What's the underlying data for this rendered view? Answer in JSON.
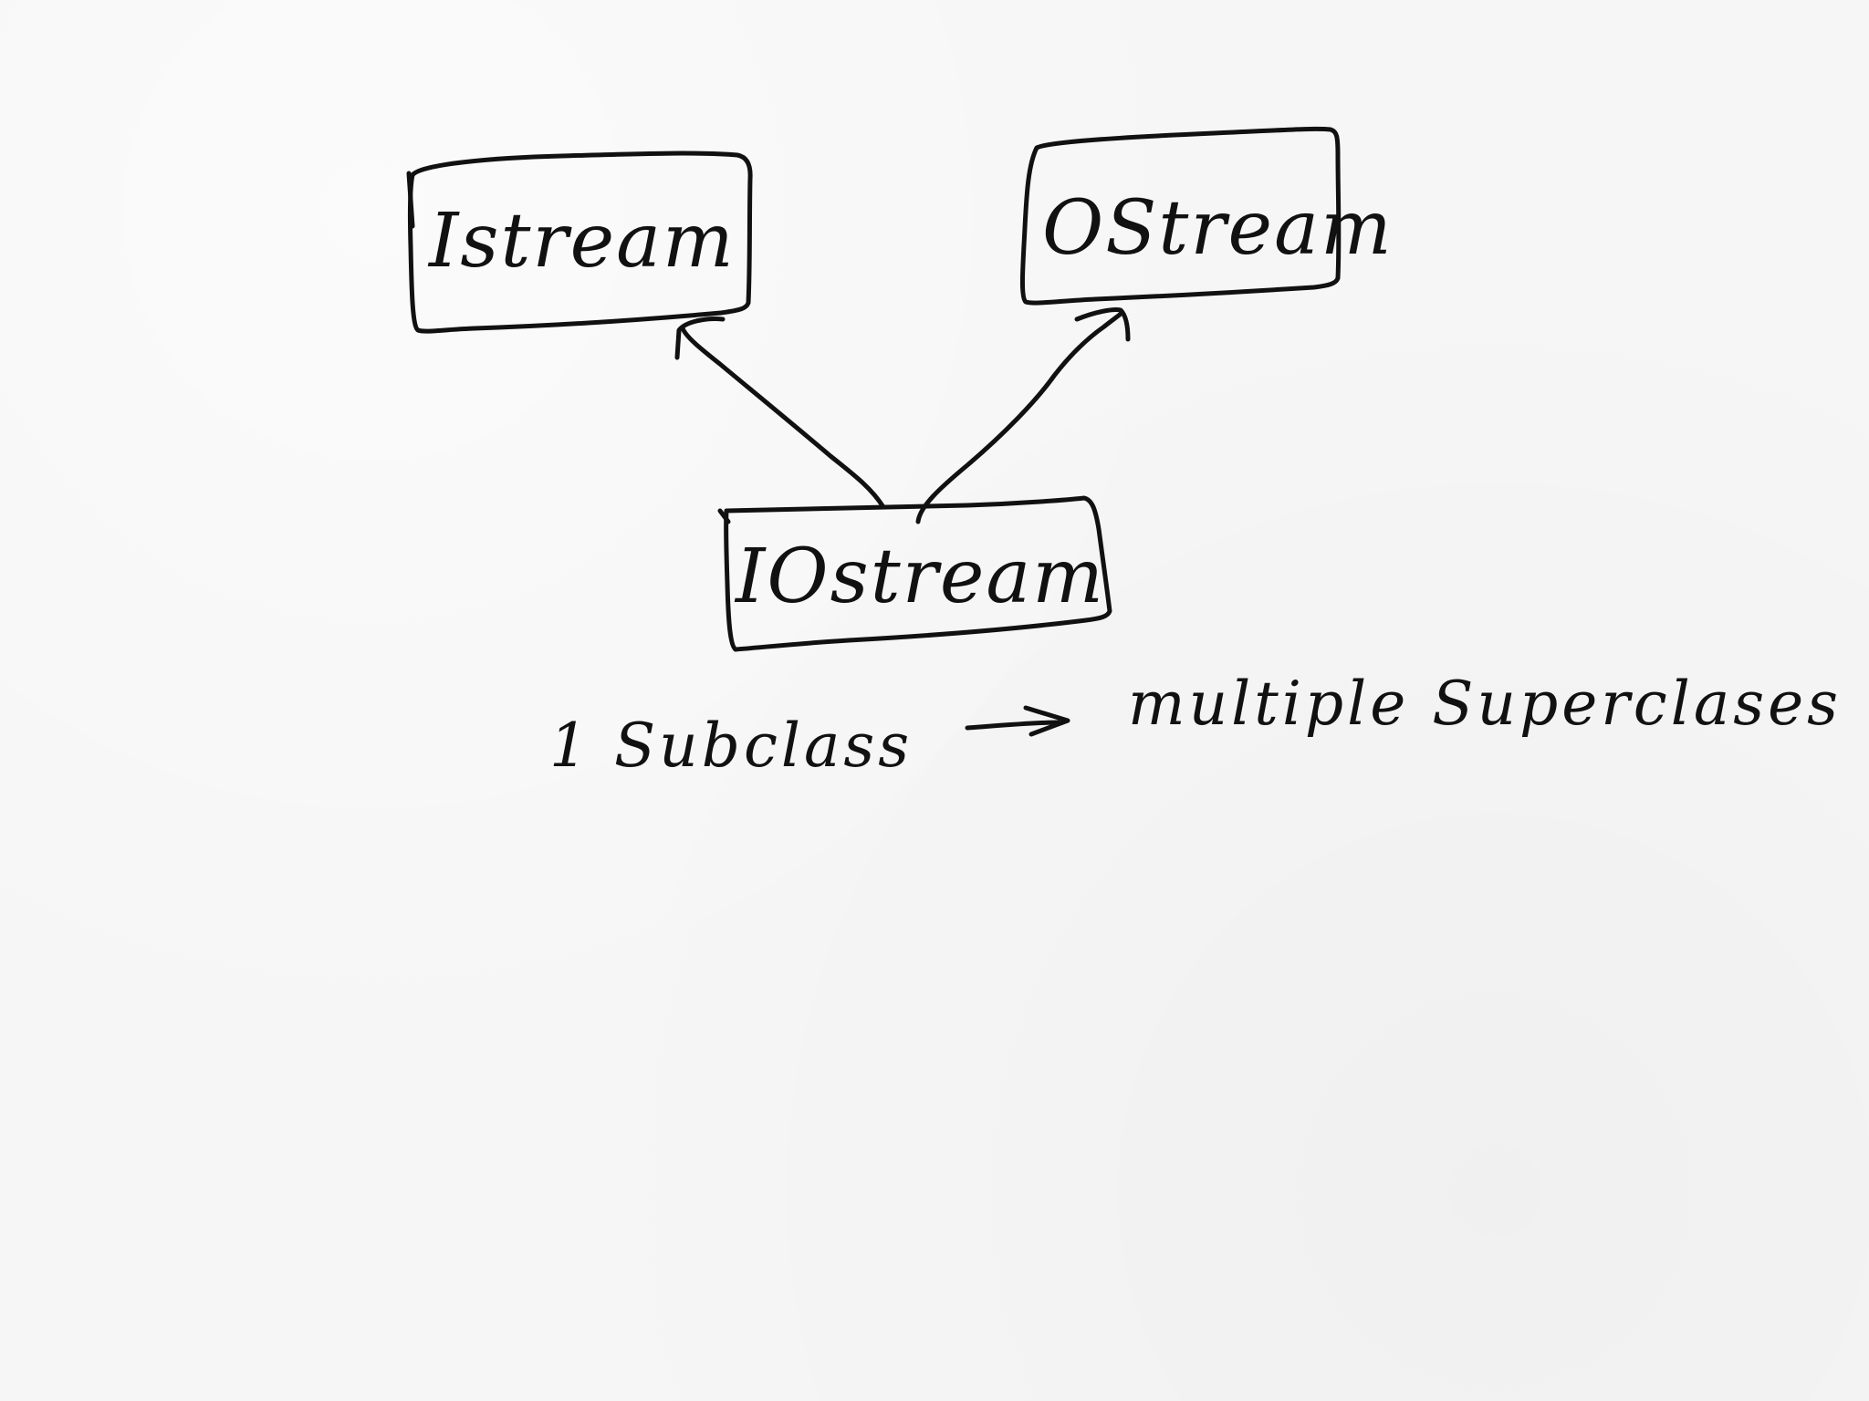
{
  "nodes": {
    "istream": {
      "label": "Istream"
    },
    "ostream": {
      "label": "OStream"
    },
    "iostream": {
      "label": "IOstream"
    }
  },
  "note": {
    "left": "1 Subclass",
    "arrow": "->",
    "right": "multiple Superclases"
  },
  "colors": {
    "ink": "#111111",
    "paper": "#f6f6f6"
  }
}
